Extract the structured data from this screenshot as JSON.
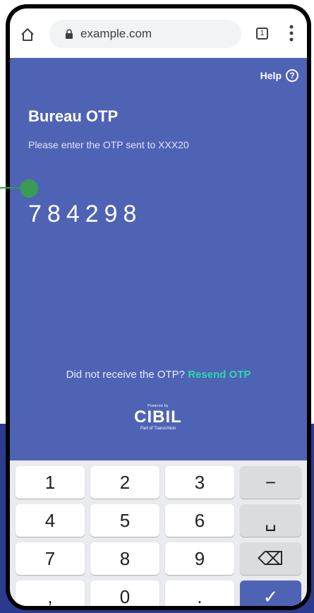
{
  "browser": {
    "url": "example.com",
    "tab_count": "1",
    "icons": [
      "home-icon",
      "lock-icon",
      "tabs-icon",
      "menu-icon"
    ]
  },
  "page": {
    "help_label": "Help",
    "help_icon_glyph": "?",
    "title": "Bureau OTP",
    "subtitle": "Please enter the OTP sent to XXX20",
    "otp_value": "784298",
    "resend_prompt": "Did not receive the OTP?",
    "resend_link": "Resend OTP",
    "logo": {
      "powered_by": "Powered by",
      "name": "CIBIL",
      "tagline": "Part of TransUnion"
    }
  },
  "keypad": {
    "keys": [
      {
        "label": "1"
      },
      {
        "label": "2"
      },
      {
        "label": "3"
      },
      {
        "label": "−"
      },
      {
        "label": "4"
      },
      {
        "label": "5"
      },
      {
        "label": "6"
      },
      {
        "label": "␣"
      },
      {
        "label": "7"
      },
      {
        "label": "8"
      },
      {
        "label": "9"
      },
      {
        "label": "⌫"
      },
      {
        "label": ","
      },
      {
        "label": "0"
      },
      {
        "label": "."
      },
      {
        "label": "✓"
      }
    ]
  },
  "colors": {
    "page_background": "#4f63b5",
    "accent_link": "#2bd9a7",
    "keypad_background": "#e9ebee"
  }
}
